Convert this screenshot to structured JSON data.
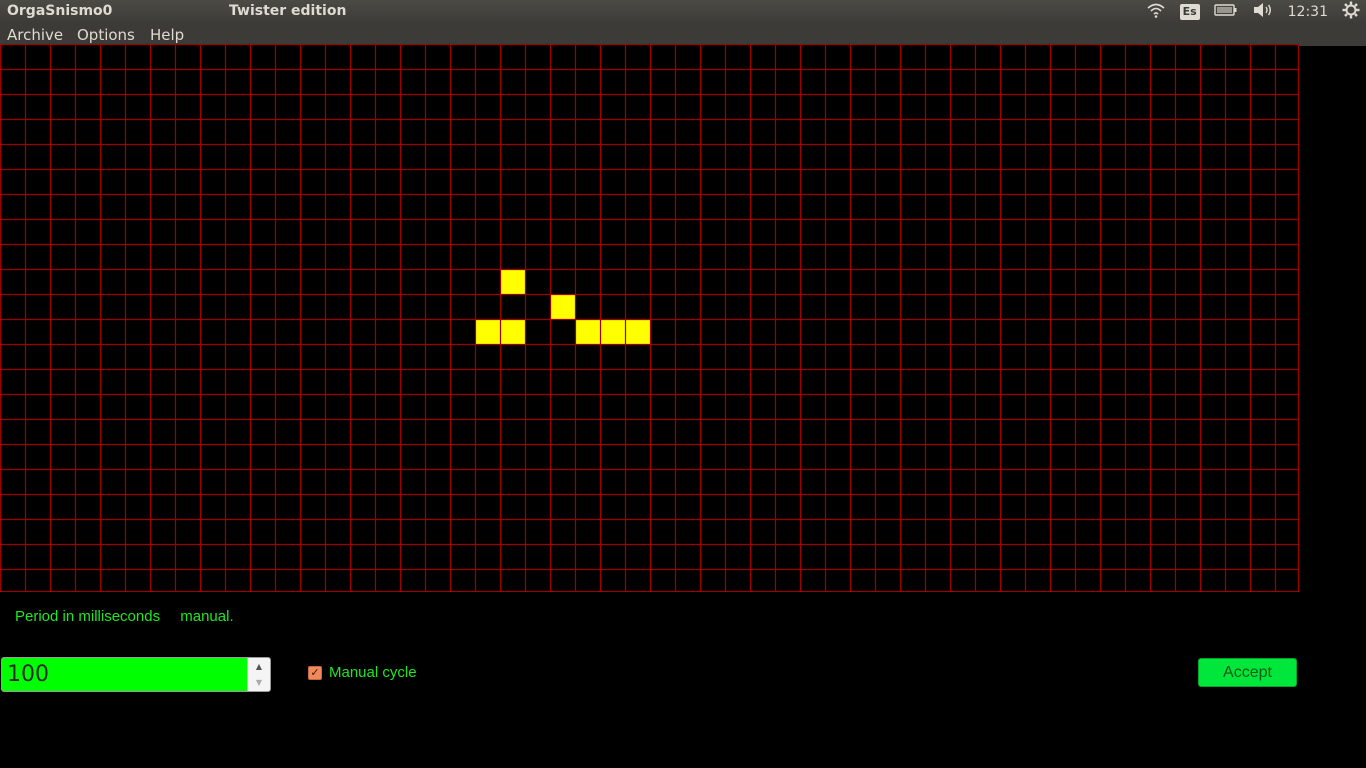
{
  "app": {
    "name": "OrgaSnismo0",
    "window_title": "Twister edition"
  },
  "tray": {
    "wifi_icon": "wifi-icon",
    "keyboard_layout": "Es",
    "battery_icon": "battery-icon",
    "volume_icon": "volume-icon",
    "clock": "12:31",
    "settings_icon": "gear-icon"
  },
  "menu": {
    "items": [
      "Archive",
      "Options",
      "Help"
    ]
  },
  "grid": {
    "columns": 52,
    "rows": 22,
    "line_color": "#a00000",
    "alive_color": "#ffff00",
    "alive_cells": [
      [
        20,
        9
      ],
      [
        22,
        10
      ],
      [
        19,
        11
      ],
      [
        20,
        11
      ],
      [
        23,
        11
      ],
      [
        24,
        11
      ],
      [
        25,
        11
      ]
    ]
  },
  "status": {
    "period_label": "Period in milliseconds",
    "mode_label": "manual."
  },
  "controls": {
    "period_value": "100",
    "manual_cycle_label": "Manual cycle",
    "manual_cycle_checked": true,
    "accept_label": "Accept"
  },
  "colors": {
    "text_green": "#1ee81e",
    "spin_bg": "#00ff00",
    "accept_bg": "#00e63a"
  }
}
